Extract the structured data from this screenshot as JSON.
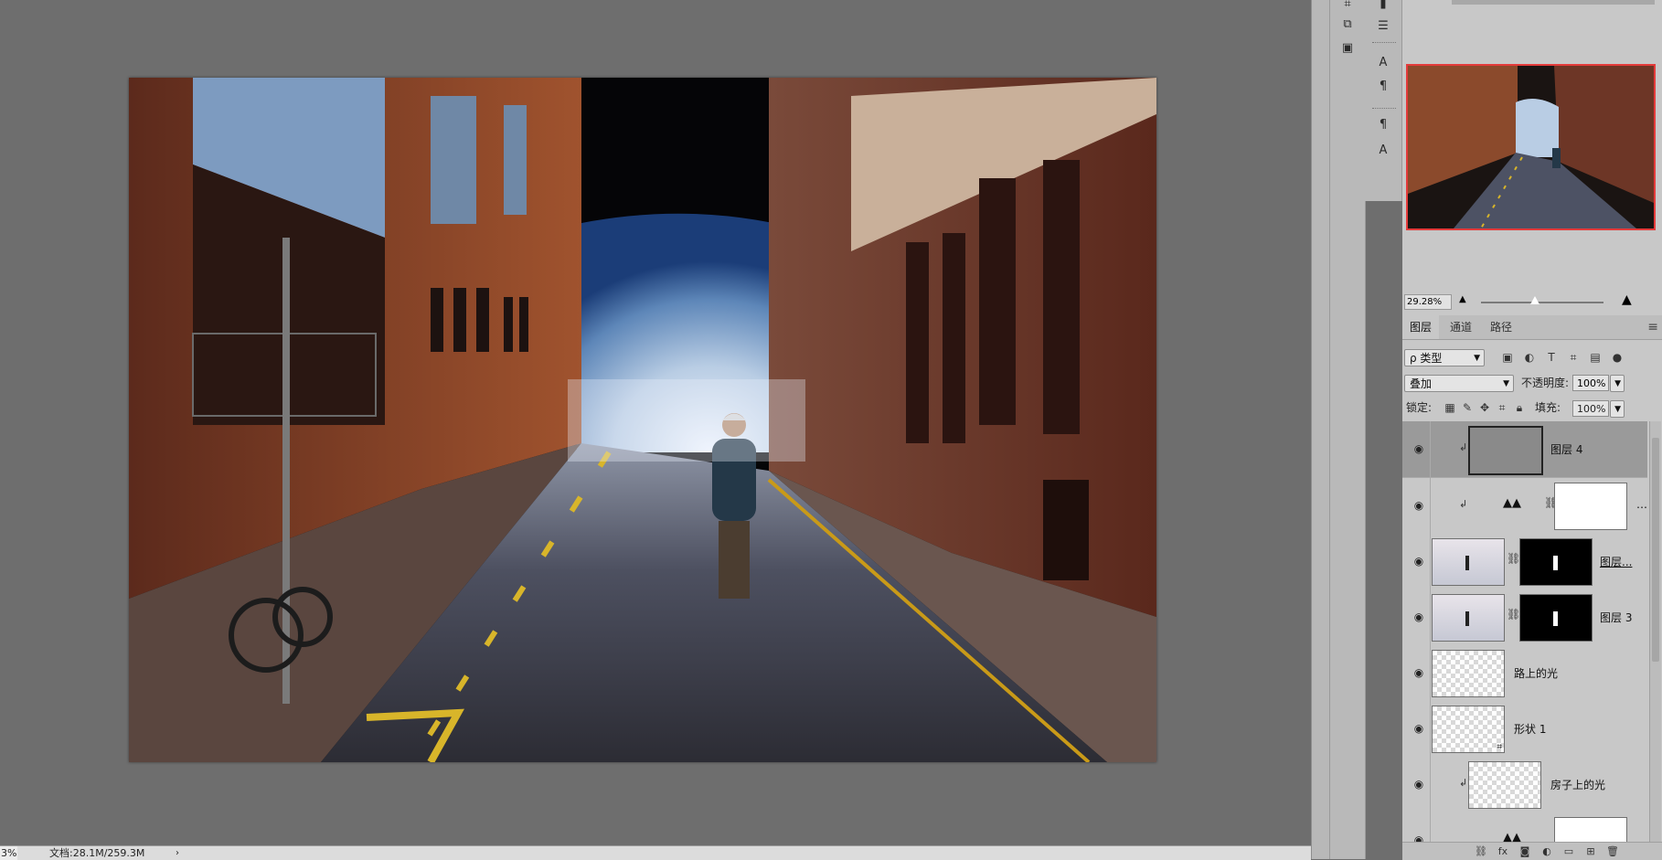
{
  "status_bar": {
    "zoom": "3%",
    "doc_info": "文档:28.1M/259.3M",
    "arrow": "›"
  },
  "tools": {
    "icons": [
      "clone-source-icon",
      "properties-icon",
      "measurement-icon",
      "character-icon",
      "paragraph-icon",
      "paragraph-style-icon",
      "character-style-icon"
    ]
  },
  "navigator": {
    "zoom_value": "29.28%"
  },
  "layers_panel": {
    "tabs": [
      "图层",
      "通道",
      "路径"
    ],
    "filter_kind": "ρ 类型",
    "blend_mode": "叠加",
    "opacity_label": "不透明度:",
    "opacity_value": "100%",
    "lock_label": "锁定:",
    "fill_label": "填充:",
    "fill_value": "100%",
    "layers": [
      {
        "name": "图层 4",
        "selected": true
      },
      {
        "name": "…",
        "selected": false
      },
      {
        "name": "图层...",
        "selected": false
      },
      {
        "name": "图层 3",
        "selected": false
      },
      {
        "name": "路上的光",
        "selected": false
      },
      {
        "name": "形状 1",
        "selected": false
      },
      {
        "name": "房子上的光",
        "selected": false
      }
    ]
  },
  "colors": {
    "canvas_bg": "#6e6e6e",
    "panel_bg": "#c8c8c8",
    "selected_layer": "#9a9a9a",
    "nav_frame": "#e43b3b"
  }
}
